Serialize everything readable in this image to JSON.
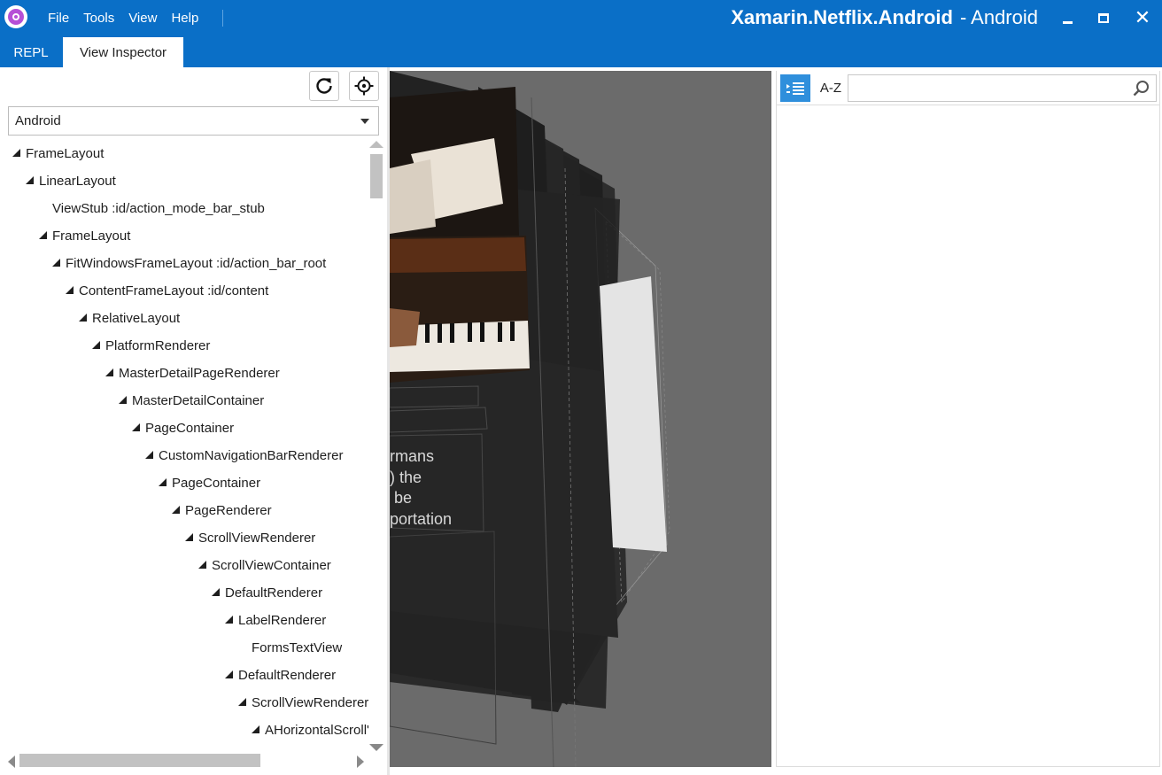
{
  "app": {
    "project_name": "Xamarin.Netflix.Android",
    "platform": "- Android"
  },
  "menu": [
    "File",
    "Tools",
    "View",
    "Help"
  ],
  "window_controls": {
    "minimize": "minimize",
    "maximize": "maximize",
    "close": "✕"
  },
  "tabs": [
    "REPL",
    "View Inspector"
  ],
  "inspector": {
    "platform_select": "Android",
    "tree": [
      {
        "label": "FrameLayout",
        "depth": 0,
        "expanded": true
      },
      {
        "label": "LinearLayout",
        "depth": 1,
        "expanded": true
      },
      {
        "label": "ViewStub :id/action_mode_bar_stub",
        "depth": 2,
        "expanded": false
      },
      {
        "label": "FrameLayout",
        "depth": 2,
        "expanded": true
      },
      {
        "label": "FitWindowsFrameLayout :id/action_bar_root",
        "depth": 3,
        "expanded": true
      },
      {
        "label": "ContentFrameLayout :id/content",
        "depth": 4,
        "expanded": true
      },
      {
        "label": "RelativeLayout",
        "depth": 5,
        "expanded": true
      },
      {
        "label": "PlatformRenderer",
        "depth": 6,
        "expanded": true
      },
      {
        "label": "MasterDetailPageRenderer",
        "depth": 7,
        "expanded": true
      },
      {
        "label": "MasterDetailContainer",
        "depth": 8,
        "expanded": true
      },
      {
        "label": "PageContainer",
        "depth": 9,
        "expanded": true
      },
      {
        "label": "CustomNavigationBarRenderer",
        "depth": 10,
        "expanded": true
      },
      {
        "label": "PageContainer",
        "depth": 11,
        "expanded": true
      },
      {
        "label": "PageRenderer",
        "depth": 12,
        "expanded": true
      },
      {
        "label": "ScrollViewRenderer",
        "depth": 13,
        "expanded": true
      },
      {
        "label": "ScrollViewContainer",
        "depth": 14,
        "expanded": true
      },
      {
        "label": "DefaultRenderer",
        "depth": 15,
        "expanded": true
      },
      {
        "label": "LabelRenderer",
        "depth": 16,
        "expanded": true
      },
      {
        "label": "FormsTextView",
        "depth": 17,
        "expanded": false
      },
      {
        "label": "DefaultRenderer",
        "depth": 16,
        "expanded": true
      },
      {
        "label": "ScrollViewRenderer",
        "depth": 17,
        "expanded": true
      },
      {
        "label": "AHorizontalScroll'",
        "depth": 18,
        "expanded": true
      }
    ]
  },
  "viewport": {
    "overlay_text": "rmans\n) the\n be\nportation"
  },
  "properties": {
    "categorized_icon": "list-icon",
    "az_label": "A-Z",
    "search_value": "",
    "search_icon": "search-icon"
  },
  "colors": {
    "titlebar": "#0a6fc7",
    "accent": "#2f8fdc",
    "viewport_bg": "#6b6b6b"
  }
}
